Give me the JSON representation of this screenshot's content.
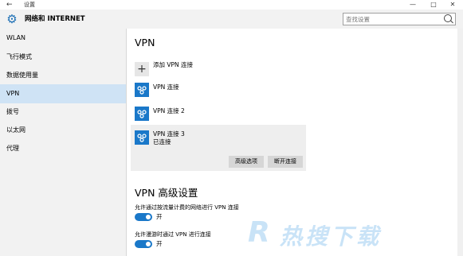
{
  "window": {
    "title": "设置",
    "back": "←",
    "minimize": "—",
    "maximize": "□",
    "close": "✕"
  },
  "header": {
    "breadcrumb": "网络和 INTERNET"
  },
  "search": {
    "placeholder": "查找设置"
  },
  "sidebar": {
    "items": [
      {
        "label": "WLAN"
      },
      {
        "label": "飞行模式"
      },
      {
        "label": "数据使用量"
      },
      {
        "label": "VPN",
        "active": true
      },
      {
        "label": "拨号"
      },
      {
        "label": "以太网"
      },
      {
        "label": "代理"
      }
    ]
  },
  "main": {
    "title": "VPN",
    "add_vpn_label": "添加 VPN 连接",
    "connections": [
      {
        "name": "VPN 连接"
      },
      {
        "name": "VPN 连接 2"
      },
      {
        "name": "VPN 连接 3",
        "status": "已连接"
      }
    ],
    "advanced_button": "高级选项",
    "disconnect_button": "断开连接",
    "advanced_title": "VPN 高级设置",
    "options": [
      {
        "label": "允许通过按流量计费的网络进行 VPN 连接",
        "state": "开",
        "on": true
      },
      {
        "label": "允许漫游时通过 VPN 进行连接",
        "state": "开",
        "on": true
      }
    ]
  },
  "watermark": {
    "logo": "R",
    "text": "热搜下载"
  },
  "colors": {
    "accent": "#1a78c9",
    "selected": "#cfe3f5",
    "panel": "#f2f2f2"
  }
}
